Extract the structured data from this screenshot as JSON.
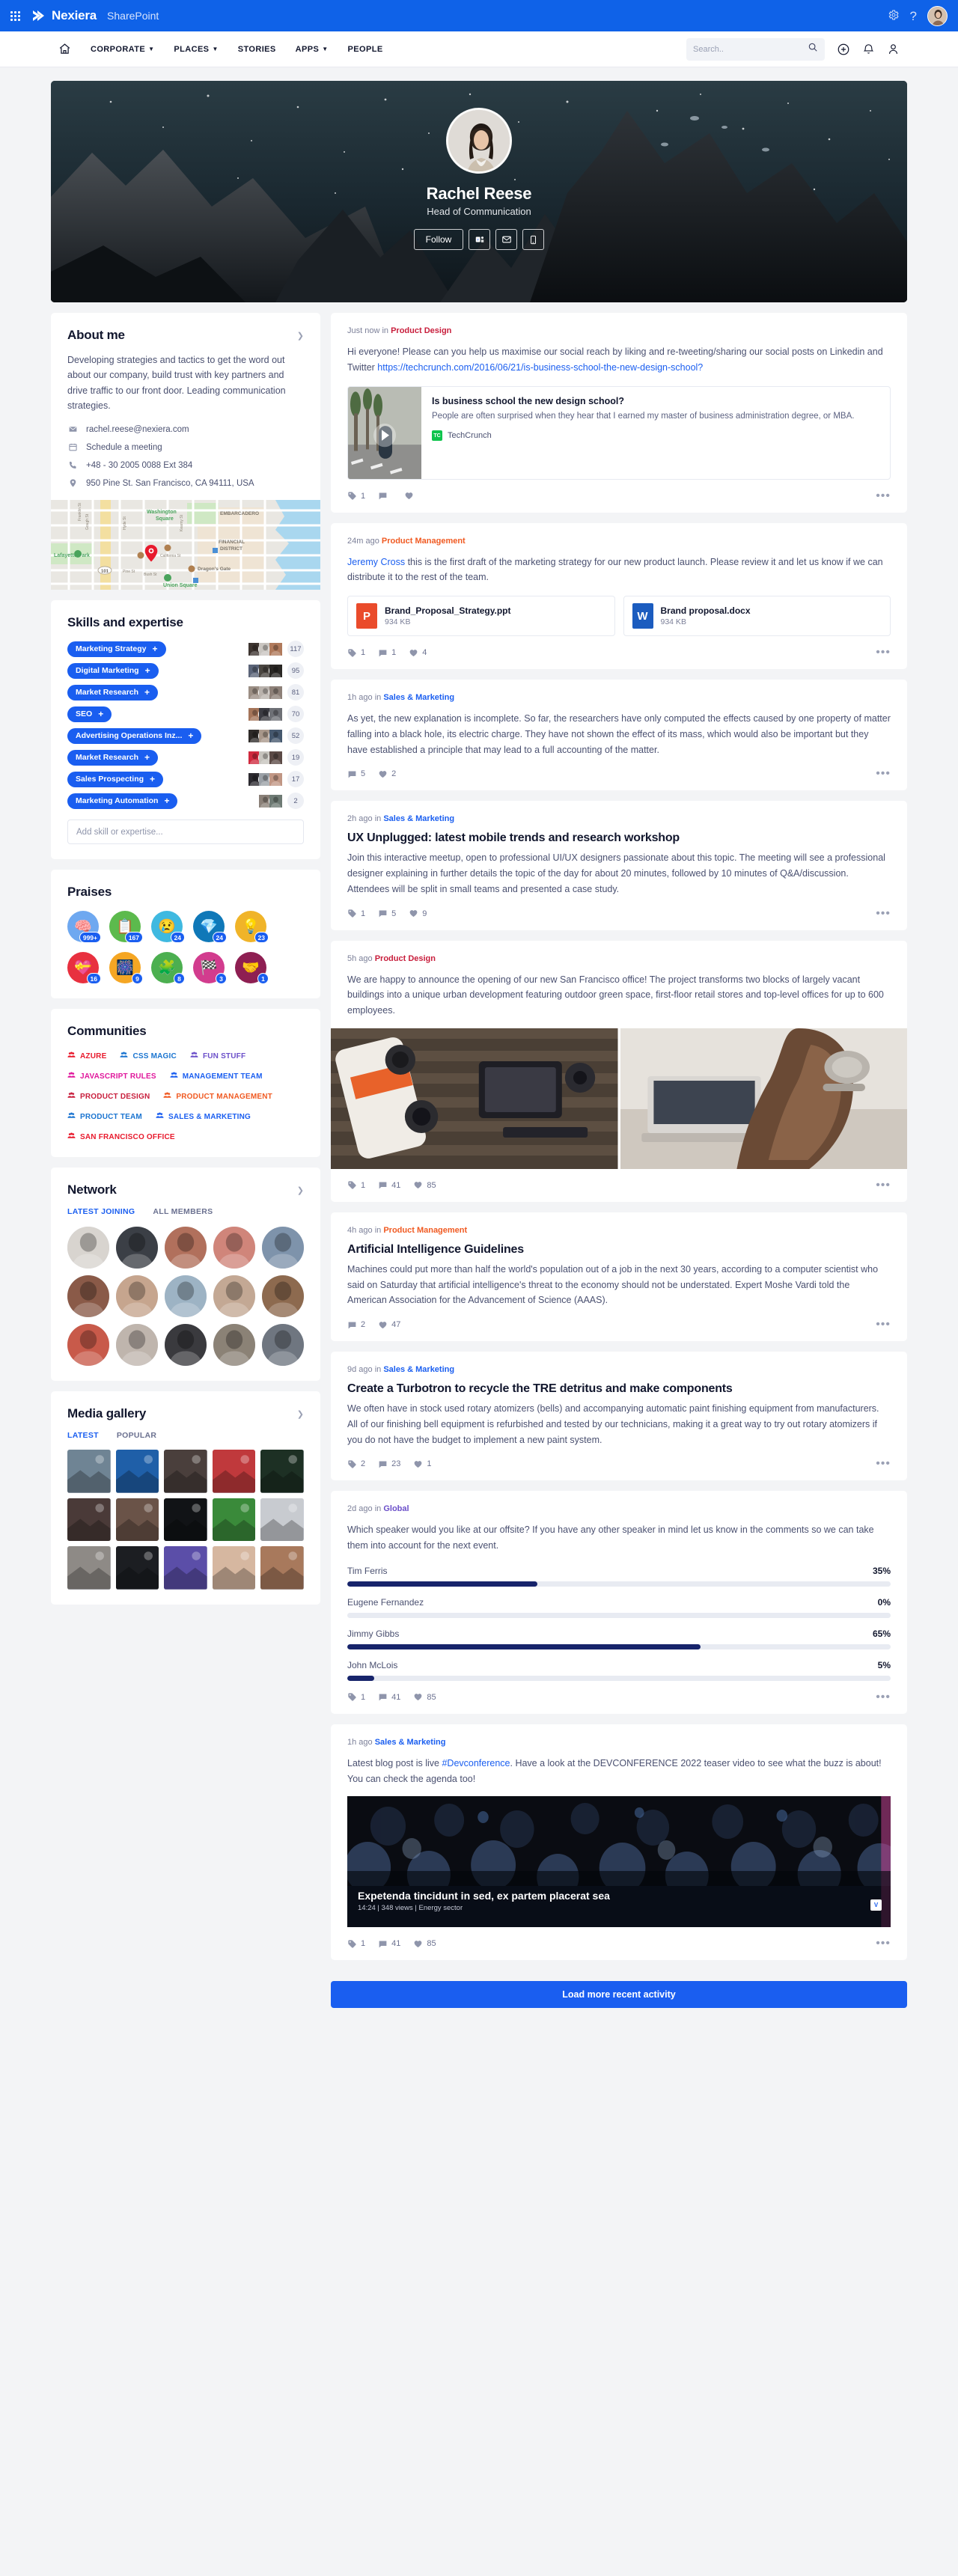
{
  "suite": {
    "waffle_icon": "app-launcher-icon",
    "brand": "Nexiera",
    "app": "SharePoint",
    "settings_icon": "gear-icon",
    "help_icon": "help-icon",
    "avatar": "user-avatar"
  },
  "nav": {
    "home_icon": "home-icon",
    "links": [
      {
        "label": "CORPORATE",
        "caret": true
      },
      {
        "label": "PLACES",
        "caret": true
      },
      {
        "label": "STORIES",
        "caret": false
      },
      {
        "label": "APPS",
        "caret": true
      },
      {
        "label": "PEOPLE",
        "caret": false
      }
    ],
    "search_placeholder": "Search..",
    "search_value": "",
    "search_icon": "search-icon",
    "add_icon": "plus-circle-icon",
    "bell_icon": "bell-icon",
    "user_icon": "person-icon"
  },
  "hero": {
    "name": "Rachel Reese",
    "role": "Head of Communication",
    "follow_label": "Follow",
    "action_icons": [
      "teams-icon",
      "mail-icon",
      "phone-icon"
    ]
  },
  "about": {
    "title": "About me",
    "bio": "Developing strategies and tactics to get the word out about our company, build trust with key partners and drive traffic to our front door. Leading communication strategies.",
    "rows": [
      {
        "icon": "mail-icon",
        "text": "rachel.reese@nexiera.com"
      },
      {
        "icon": "calendar-icon",
        "text": "Schedule a meeting"
      },
      {
        "icon": "phone-icon",
        "text": "+48 - 30 2005 0088 Ext 384"
      },
      {
        "icon": "location-pin-icon",
        "text": "950 Pine St. San Francisco, CA 94111, USA"
      }
    ],
    "map_labels": [
      "Washington Square",
      "EMBARCADERO",
      "Lafayette Park",
      "FINANCIAL DISTRICT",
      "Dragon's Gate",
      "Union Square",
      "Franklin St",
      "Gough St",
      "Hyde St",
      "Kearny St",
      "California St",
      "Pine St",
      "Bush St",
      "101"
    ]
  },
  "skills": {
    "title": "Skills and expertise",
    "items": [
      {
        "label": "Marketing Strategy",
        "count": "117",
        "endorsers": 3,
        "colors": [
          "#3d3430",
          "#c9c5c0",
          "#b07a5c"
        ]
      },
      {
        "label": "Digital Marketing",
        "count": "95",
        "endorsers": 3,
        "colors": [
          "#5b6478",
          "#4a4540",
          "#2a2724"
        ]
      },
      {
        "label": "Market Research",
        "count": "81",
        "endorsers": 3,
        "colors": [
          "#9b8e84",
          "#b9b2ac",
          "#8d8078"
        ]
      },
      {
        "label": "SEO",
        "count": "70",
        "endorsers": 3,
        "colors": [
          "#a5755a",
          "#3b3b42",
          "#6e7076"
        ]
      },
      {
        "label": "Advertising Operations Inz...",
        "count": "52",
        "endorsers": 3,
        "colors": [
          "#2e2a28",
          "#a8978a",
          "#46586e"
        ]
      },
      {
        "label": "Market Research",
        "count": "19",
        "endorsers": 3,
        "colors": [
          "#d02a3e",
          "#c6c3bd",
          "#5b4a46"
        ]
      },
      {
        "label": "Sales Prospecting",
        "count": "17",
        "endorsers": 3,
        "colors": [
          "#2c2a30",
          "#9aa0a6",
          "#c09684"
        ]
      },
      {
        "label": "Marketing Automation",
        "count": "2",
        "endorsers": 2,
        "colors": [
          "#8a8078",
          "#6e7a74"
        ]
      }
    ],
    "add_placeholder": "Add skill or expertise...",
    "add_value": ""
  },
  "praises": {
    "title": "Praises",
    "items": [
      {
        "name": "brain-praise",
        "glyph": "🧠",
        "count": "999+",
        "bg": "#6ea8f0"
      },
      {
        "name": "clipboard-praise",
        "glyph": "📋",
        "count": "167",
        "bg": "#5cba4d"
      },
      {
        "name": "sad-face-praise",
        "glyph": "😢",
        "count": "24",
        "bg": "#3fb9e0"
      },
      {
        "name": "diamond-praise",
        "glyph": "💎",
        "count": "24",
        "bg": "#0f78b8"
      },
      {
        "name": "lightbulb-praise",
        "glyph": "💡",
        "count": "23",
        "bg": "#f0b429"
      },
      {
        "name": "heart-hands-praise",
        "glyph": "💝",
        "count": "16",
        "bg": "#e8303f"
      },
      {
        "name": "fireworks-praise",
        "glyph": "🎆",
        "count": "9",
        "bg": "#f5a623"
      },
      {
        "name": "puzzle-brain-praise",
        "glyph": "🧩",
        "count": "8",
        "bg": "#4caf50"
      },
      {
        "name": "checkered-flag-praise",
        "glyph": "🏁",
        "count": "3",
        "bg": "#d23c8e"
      },
      {
        "name": "handshake-praise",
        "glyph": "🤝",
        "count": "1",
        "bg": "#8e1f52"
      }
    ]
  },
  "communities": {
    "title": "Communities",
    "icon": "people-group-icon",
    "items": [
      {
        "label": "AZURE",
        "color": "#e8192c"
      },
      {
        "label": "CSS MAGIC",
        "color": "#1a74d0"
      },
      {
        "label": "FUN STUFF",
        "color": "#6b4fc9"
      },
      {
        "label": "JAVASCRIPT RULES",
        "color": "#e0189c"
      },
      {
        "label": "MANAGEMENT TEAM",
        "color": "#1a5ef0"
      },
      {
        "label": "PRODUCT DESIGN",
        "color": "#c81e3c"
      },
      {
        "label": "PRODUCT MANAGEMENT",
        "color": "#f05a22"
      },
      {
        "label": "PRODUCT TEAM",
        "color": "#1a74d0"
      },
      {
        "label": "SALES & MARKETING",
        "color": "#1a5ef0"
      },
      {
        "label": "SAN FRANCISCO OFFICE",
        "color": "#e8192c"
      }
    ]
  },
  "network": {
    "title": "Network",
    "tabs": [
      {
        "label": "LATEST JOINING",
        "active": true
      },
      {
        "label": "ALL MEMBERS",
        "active": false
      }
    ],
    "avatars": [
      "#d8d4cf",
      "#3b3f46",
      "#b1705c",
      "#d0857a",
      "#7e93ab",
      "#8a5a48",
      "#c6a58e",
      "#9db3c4",
      "#c3a894",
      "#8d6a4f",
      "#c85a4a",
      "#bfb5ad",
      "#3a3a3e",
      "#8b8276",
      "#6f7680"
    ]
  },
  "media": {
    "title": "Media gallery",
    "tabs": [
      {
        "label": "LATEST",
        "active": true
      },
      {
        "label": "POPULAR",
        "active": false
      }
    ],
    "thumbs": [
      "#6f8494",
      "#1f5fa8",
      "#4a3f3c",
      "#c0393c",
      "#1d3024",
      "#4a3a38",
      "#6a5348",
      "#111316",
      "#3a8a3a",
      "#c8cbd0",
      "#8e8a86",
      "#1c1e22",
      "#5b4ea8",
      "#d6b7a0",
      "#a8795c"
    ]
  },
  "feed": {
    "posts": [
      {
        "id": "post-social-reach",
        "time": "Just now in ",
        "community": "Product Design",
        "community_color": "#c81e3c",
        "title": "",
        "body_pre": "Hi everyone! Please can you help us maximise our social reach by liking and re-tweeting/sharing our social posts on Linkedin and Twitter ",
        "link_text": "https://techcrunch.com/2016/06/21/is-business-school-the-new-design-school?",
        "link_card": {
          "title": "Is business school the new design school?",
          "desc": "People are often surprised when they hear that I earned my master of business administration degree, or MBA.",
          "source": "TechCrunch",
          "badge": "TC",
          "play_icon": "play-circle-icon"
        },
        "actions": {
          "tag": "1",
          "comment": "",
          "like": ""
        }
      },
      {
        "id": "post-brand-proposal",
        "time": "24m ago ",
        "community": "Product Management",
        "community_color": "#f05a22",
        "mention": "Jeremy Cross",
        "body_post_mention": " this is the first draft of the marketing strategy for our new product launch. Please review it and let us know if we can distribute it to the rest of the team.",
        "files": [
          {
            "name": "Brand_Proposal_Strategy.ppt",
            "size": "934 KB",
            "badge": "P",
            "color": "#ea4b2b"
          },
          {
            "name": "Brand proposal.docx",
            "size": "934 KB",
            "badge": "W",
            "color": "#1b5cbf"
          }
        ],
        "actions": {
          "tag": "1",
          "comment": "1",
          "like": "4"
        }
      },
      {
        "id": "post-black-hole",
        "time": "1h ago in ",
        "community": "Sales & Marketing",
        "community_color": "#1a5ef0",
        "body": "As yet, the new explanation is incomplete. So far, the researchers have only computed the effects caused by one property of matter falling into a black hole, its electric charge. They have not shown the effect of its mass, which would also be important but they have established a principle that may lead to a full accounting of the matter.",
        "actions": {
          "comment": "5",
          "like": "2"
        }
      },
      {
        "id": "post-ux-unplugged",
        "time": "2h ago in ",
        "community": "Sales & Marketing",
        "community_color": "#1a5ef0",
        "title": "UX Unplugged: latest mobile trends and research workshop",
        "body": "Join this interactive meetup, open to professional UI/UX designers passionate about this topic. The meeting will see a professional designer explaining in further details the topic of the day for about 20 minutes, followed by 10 minutes of Q&A/discussion. Attendees will be split in small teams and presented a case study.",
        "actions": {
          "tag": "1",
          "comment": "5",
          "like": "9"
        }
      },
      {
        "id": "post-sf-office",
        "time": "5h ago ",
        "community": "Product Design",
        "community_color": "#c81e3c",
        "body": "We are happy to announce the opening of our new San Francisco office! The project transforms two blocks of largely vacant buildings into a unique urban development featuring outdoor green space, first-floor retail stores and top-level offices for up to 600 employees.",
        "images": [
          "#3a4a3e",
          "#cbc7c2"
        ],
        "actions": {
          "tag": "1",
          "comment": "41",
          "like": "85"
        }
      },
      {
        "id": "post-ai-guidelines",
        "time": "4h ago in ",
        "community": "Product Management",
        "community_color": "#f05a22",
        "title": "Artificial Intelligence Guidelines",
        "body": "Machines could put more than half the world's population out of a job in the next 30 years, according to a computer scientist who said on Saturday that artificial intelligence's threat to the economy should not be understated. Expert Moshe Vardi told the American Association for the Advancement of Science (AAAS).",
        "actions": {
          "comment": "2",
          "like": "47"
        }
      },
      {
        "id": "post-turbotron",
        "time": "9d ago in ",
        "community": "Sales & Marketing",
        "community_color": "#1a5ef0",
        "title": "Create a Turbotron to recycle the TRE detritus and make components",
        "body": "We often have in stock used rotary atomizers (bells) and accompanying automatic paint finishing equipment from manufacturers. All of our finishing bell equipment is refurbished and tested by our technicians, making it a great way to try out rotary atomizers if you do not have the budget to implement a new paint system.",
        "actions": {
          "tag": "2",
          "comment": "23",
          "like": "1"
        }
      },
      {
        "id": "post-speaker-poll",
        "time": "2d ago in ",
        "community": "Global",
        "community_color": "#6b4fc9",
        "body": "Which speaker would you like at our offsite? If you have any other speaker in mind let us know in the comments so we can take them into account for the next event.",
        "actions": {
          "tag": "1",
          "comment": "41",
          "like": "85"
        }
      },
      {
        "id": "post-devconference",
        "time": "1h ago ",
        "community": "Sales & Marketing",
        "community_color": "#1a5ef0",
        "body_pre": "Latest blog post is live ",
        "hashtag": "#Devconference",
        "body_post": ". Have a look at the DEVCONFERENCE 2022 teaser video to see what the buzz is about! You can check the agenda too!",
        "video": {
          "title": "Expetenda tincidunt in sed, ex partem placerat sea",
          "meta": "14:24 | 348 views | Energy sector",
          "badge": "V"
        },
        "actions": {
          "tag": "1",
          "comment": "41",
          "like": "85"
        }
      }
    ],
    "load_more_label": "Load more recent activity"
  },
  "chart_data": {
    "type": "bar",
    "title": "Which speaker would you like at our offsite? If you have any other speaker in mind let us know in the comments so we can take them into account for the next event.",
    "orientation": "horizontal",
    "categories": [
      "Tim Ferris",
      "Eugene Fernandez",
      "Jimmy Gibbs",
      "John McLois"
    ],
    "values": [
      35,
      0,
      65,
      5
    ],
    "value_labels": [
      "35%",
      "0%",
      "65%",
      "5%"
    ],
    "xlabel": "",
    "ylabel": "",
    "xlim": [
      0,
      100
    ],
    "grid": false,
    "legend": "none",
    "bar_color": "#17246b",
    "track_color": "#e8ebf2"
  },
  "icons": {
    "tag": "tag-icon",
    "comment": "comment-icon",
    "like": "heart-icon",
    "more": "more-horizontal-icon"
  }
}
